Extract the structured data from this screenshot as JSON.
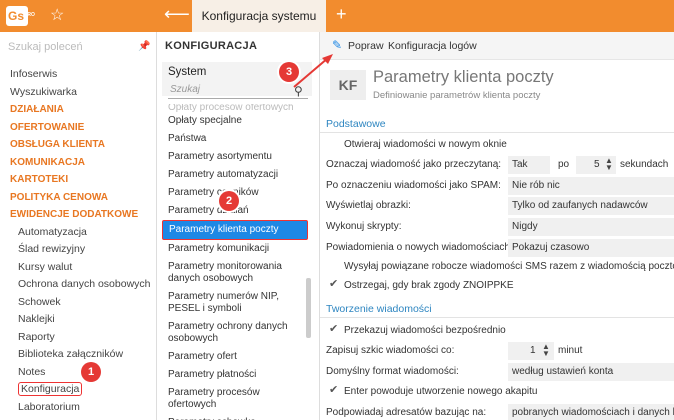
{
  "topbar": {
    "logo_text": "Gs",
    "logo_sup": "PRO",
    "active_tab": "Konfiguracja systemu"
  },
  "leftnav": {
    "search_placeholder": "Szukaj poleceń",
    "items": [
      {
        "label": "Infoserwis",
        "type": "item"
      },
      {
        "label": "Wyszukiwarka",
        "type": "item"
      },
      {
        "label": "DZIAŁANIA",
        "type": "cat"
      },
      {
        "label": "OFERTOWANIE",
        "type": "cat"
      },
      {
        "label": "OBSŁUGA KLIENTA",
        "type": "cat"
      },
      {
        "label": "KOMUNIKACJA",
        "type": "cat"
      },
      {
        "label": "KARTOTEKI",
        "type": "cat"
      },
      {
        "label": "POLITYKA CENOWA",
        "type": "cat"
      },
      {
        "label": "EWIDENCJE DODATKOWE",
        "type": "cat"
      },
      {
        "label": "Automatyzacja",
        "type": "sub"
      },
      {
        "label": "Ślad rewizyjny",
        "type": "sub"
      },
      {
        "label": "Kursy walut",
        "type": "sub"
      },
      {
        "label": "Ochrona danych osobowych",
        "type": "sub"
      },
      {
        "label": "Schowek",
        "type": "sub"
      },
      {
        "label": "Naklejki",
        "type": "sub"
      },
      {
        "label": "Raporty",
        "type": "sub"
      },
      {
        "label": "Biblioteka załączników",
        "type": "sub"
      },
      {
        "label": "Notes",
        "type": "sub"
      },
      {
        "label": "Konfiguracja",
        "type": "sub-active"
      },
      {
        "label": "Laboratorium",
        "type": "sub"
      }
    ]
  },
  "midcol": {
    "heading": "KONFIGURACJA",
    "system_label": "System",
    "search_placeholder": "Szukaj",
    "faded_item": "Opłaty procesów ofertowych",
    "items": [
      "Opłaty specjalne",
      "Państwa",
      "Parametry asortymentu",
      "Parametry automatyzacji",
      "Parametry cenników",
      "Parametry działań",
      "Parametry klienta poczty",
      "Parametry komunikacji",
      "Parametry monitorowania danych osobowych",
      "Parametry numerów NIP, PESEL i symboli",
      "Parametry ochrony danych osobowych",
      "Parametry ofert",
      "Parametry płatności",
      "Parametry procesów ofertowych",
      "Parametry schowka"
    ],
    "selected_index": 6
  },
  "content": {
    "toolbar": {
      "popraw": "Popraw",
      "konfig_logow": "Konfiguracja logów"
    },
    "header": {
      "icon_text": "KF",
      "title": "Parametry klienta poczty",
      "subtitle": "Definiowanie parametrów klienta poczty"
    },
    "sections": {
      "basic": "Podstawowe",
      "create": "Tworzenie wiadomości"
    },
    "basic": {
      "open_new_window": "Otwieraj wiadomości w nowym oknie",
      "mark_read_label": "Oznaczaj wiadomość jako przeczytaną:",
      "mark_read_value": "Tak",
      "mark_read_po": "po",
      "mark_read_seconds": "5",
      "mark_read_unit": "sekundach",
      "spam_label": "Po oznaczeniu wiadomości jako SPAM:",
      "spam_value": "Nie rób nic",
      "images_label": "Wyświetlaj obrazki:",
      "images_value": "Tylko od zaufanych nadawców",
      "scripts_label": "Wykonuj skrypty:",
      "scripts_value": "Nigdy",
      "notify_label": "Powiadomienia o nowych wiadomościach:",
      "notify_value": "Pokazuj czasowo",
      "send_sms": "Wysyłaj powiązane robocze wiadomości SMS razem z wiadomością pocztową",
      "warn_consent": "Ostrzegaj, gdy brak zgody ZNOIPPKE"
    },
    "create": {
      "forward_direct": "Przekazuj wiadomości bezpośrednio",
      "save_draft_label": "Zapisuj szkic wiadomości co:",
      "save_draft_value": "1",
      "save_draft_unit": "minut",
      "default_format_label": "Domyślny format wiadomości:",
      "default_format_value": "według ustawień konta",
      "enter_paragraph": "Enter powoduje utworzenie nowego akapitu",
      "suggest_label": "Podpowiadaj adresatów bazując na:",
      "suggest_value": "pobranych wiadomościach i danych kl"
    }
  },
  "badges": {
    "b1": "1",
    "b2": "2",
    "b3": "3"
  },
  "colors": {
    "accent": "#f28c2e",
    "selection": "#1e88e5",
    "annotation": "#e53935",
    "section": "#2e86c1"
  }
}
